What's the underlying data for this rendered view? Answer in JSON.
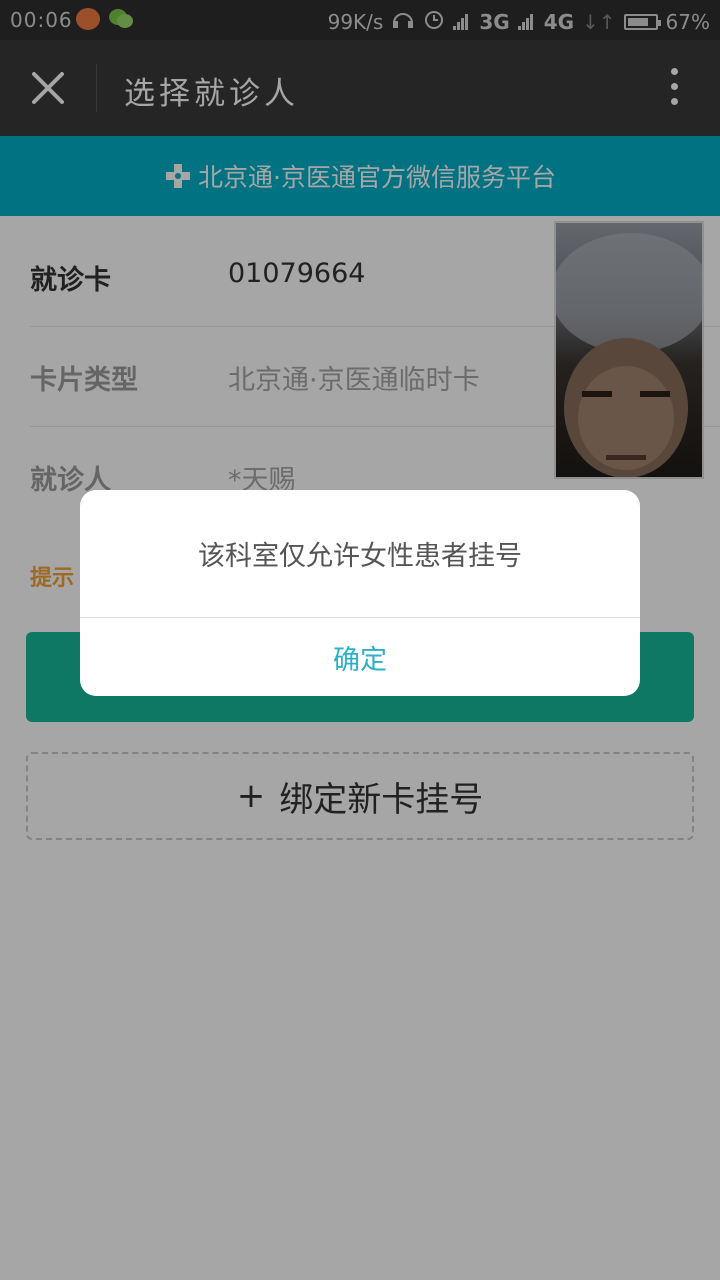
{
  "status_bar": {
    "time": "00:06",
    "net_speed": "99K/s",
    "signal_3g": "3G",
    "signal_4g": "4G",
    "battery": "67%",
    "icons": [
      "notification-app-icon",
      "wechat-icon",
      "headset-icon",
      "alarm-icon",
      "signal-icon",
      "battery-icon"
    ]
  },
  "header": {
    "title": "选择就诊人",
    "close_icon": "close-icon",
    "more_icon": "more-vertical-icon"
  },
  "banner": {
    "text": "北京通·京医通官方微信服务平台",
    "icon": "medical-cross-icon",
    "color": "#00b0c6"
  },
  "card_info": {
    "rows": [
      {
        "label": "就诊卡",
        "value": "01079664"
      },
      {
        "label": "卡片类型",
        "value": "北京通·京医通临时卡"
      },
      {
        "label": "就诊人",
        "value": "*天赐"
      }
    ]
  },
  "tip": {
    "text": "提示"
  },
  "bind_button": {
    "plus": "+",
    "label": "绑定新卡挂号"
  },
  "dialog": {
    "message": "该科室仅允许女性患者挂号",
    "confirm_label": "确定",
    "confirm_color": "#2ab1c9"
  },
  "colors": {
    "header_bg": "#39393b",
    "primary_button": "#16b89a",
    "tip": "#f3a03a"
  }
}
